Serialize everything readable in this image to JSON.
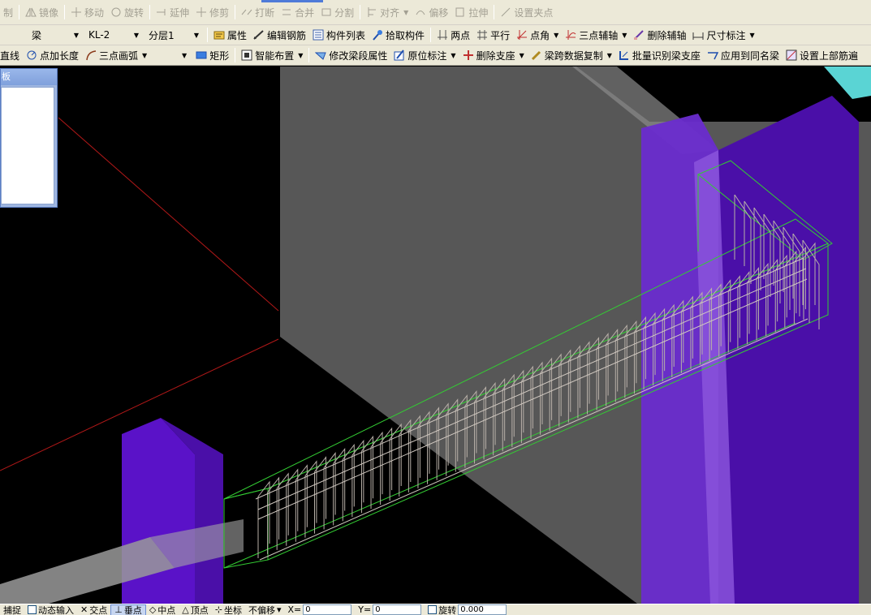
{
  "toolbar1": {
    "items": [
      {
        "label": "制",
        "icon": "mirror-edge-icon",
        "disabled": true
      },
      {
        "label": "镜像",
        "icon": "mirror-icon",
        "disabled": true
      },
      {
        "label": "移动",
        "icon": "move-icon",
        "disabled": true
      },
      {
        "label": "旋转",
        "icon": "rotate-icon",
        "disabled": true
      },
      {
        "label": "延伸",
        "icon": "extend-icon",
        "disabled": true
      },
      {
        "label": "修剪",
        "icon": "trim-icon",
        "disabled": true
      },
      {
        "label": "打断",
        "icon": "break-icon",
        "disabled": true
      },
      {
        "label": "合并",
        "icon": "merge-icon",
        "disabled": true
      },
      {
        "label": "分割",
        "icon": "split-icon",
        "disabled": true
      },
      {
        "label": "对齐",
        "icon": "align-icon",
        "disabled": true
      },
      {
        "label": "偏移",
        "icon": "offset-icon",
        "disabled": true
      },
      {
        "label": "拉伸",
        "icon": "stretch-icon",
        "disabled": true
      },
      {
        "label": "设置夹点",
        "icon": "grip-icon",
        "disabled": true
      }
    ]
  },
  "toolbar2": {
    "type_combo": "梁",
    "component_combo": "KL-2",
    "layer_combo": "分层1",
    "items": [
      {
        "label": "属性",
        "icon": "properties-icon"
      },
      {
        "label": "编辑钢筋",
        "icon": "edit-rebar-icon"
      },
      {
        "label": "构件列表",
        "icon": "component-list-icon"
      },
      {
        "label": "拾取构件",
        "icon": "pick-component-icon"
      },
      {
        "label": "两点",
        "icon": "two-point-icon"
      },
      {
        "label": "平行",
        "icon": "parallel-icon"
      },
      {
        "label": "点角",
        "icon": "point-angle-icon"
      },
      {
        "label": "三点辅轴",
        "icon": "three-point-axis-icon"
      },
      {
        "label": "删除辅轴",
        "icon": "delete-axis-icon"
      },
      {
        "label": "尺寸标注",
        "icon": "dimension-icon"
      }
    ]
  },
  "toolbar3": {
    "items": [
      {
        "label": "直线",
        "icon": "line-icon"
      },
      {
        "label": "点加长度",
        "icon": "point-length-icon"
      },
      {
        "label": "三点画弧",
        "icon": "three-point-arc-icon"
      },
      {
        "label": "矩形",
        "icon": "rectangle-icon"
      },
      {
        "label": "智能布置",
        "icon": "smart-layout-icon"
      },
      {
        "label": "修改梁段属性",
        "icon": "modify-beam-icon"
      },
      {
        "label": "原位标注",
        "icon": "in-situ-label-icon"
      },
      {
        "label": "删除支座",
        "icon": "delete-support-icon"
      },
      {
        "label": "梁跨数据复制",
        "icon": "copy-span-icon"
      },
      {
        "label": "批量识别梁支座",
        "icon": "batch-identify-icon"
      },
      {
        "label": "应用到同名梁",
        "icon": "apply-same-beam-icon"
      },
      {
        "label": "设置上部筋遍",
        "icon": "top-rebar-icon"
      }
    ]
  },
  "panel": {
    "title": "板"
  },
  "statusbar": {
    "items": [
      {
        "label": "捕捉",
        "active": false
      },
      {
        "label": "动态输入",
        "active": false
      },
      {
        "label": "交点",
        "active": false
      },
      {
        "label": "垂点",
        "active": true
      },
      {
        "label": "中点",
        "active": false
      },
      {
        "label": "顶点",
        "active": false
      },
      {
        "label": "坐标",
        "active": false
      }
    ],
    "offset_mode": "不偏移",
    "x_label": "X=",
    "x_value": "0",
    "y_label": "Y=",
    "y_value": "0",
    "rotate_label": "旋转",
    "rotate_value": "0.000"
  },
  "colors": {
    "toolbar_bg": "#ece9d8",
    "viewport_bg": "#000000",
    "column_purple": "#5a12c8",
    "slab_gray": "#555555",
    "rebar_green": "#33cc33",
    "stirrup_gray": "#b0a8a0",
    "axis_red": "#c02020"
  }
}
